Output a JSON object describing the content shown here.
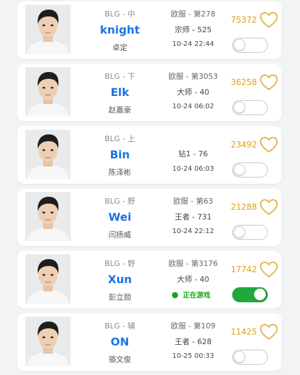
{
  "colors": {
    "accent": "#1a73e8",
    "score": "#d9a21b",
    "heart": "#e0b13a",
    "online": "#1aa31a",
    "toggle_on": "#22a83a"
  },
  "players": [
    {
      "team_role": "BLG - 中",
      "nickname": "knight",
      "real_name": "卓定",
      "server_rank": "欧服 - 第278",
      "tier": "宗师 - 525",
      "last_seen": "10-24 22:44",
      "status": "",
      "score": "75372",
      "toggle_on": false
    },
    {
      "team_role": "BLG - 下",
      "nickname": "Elk",
      "real_name": "赵嘉豪",
      "server_rank": "欧服 - 第3053",
      "tier": "大师 - 40",
      "last_seen": "10-24 06:02",
      "status": "",
      "score": "36258",
      "toggle_on": false
    },
    {
      "team_role": "BLG - 上",
      "nickname": "Bin",
      "real_name": "陈泽彬",
      "server_rank": "",
      "tier": "钻1 - 76",
      "last_seen": "10-24 06:03",
      "status": "",
      "score": "23492",
      "toggle_on": false
    },
    {
      "team_role": "BLG - 野",
      "nickname": "Wei",
      "real_name": "闫扬威",
      "server_rank": "欧服 - 第63",
      "tier": "王者 - 731",
      "last_seen": "10-24 22:12",
      "status": "",
      "score": "21288",
      "toggle_on": false
    },
    {
      "team_role": "BLG - 野",
      "nickname": "Xun",
      "real_name": "彭立勋",
      "server_rank": "欧服 - 第3176",
      "tier": "大师 - 40",
      "last_seen": "",
      "status": "正在游戏",
      "score": "17742",
      "toggle_on": true
    },
    {
      "team_role": "BLG - 辅",
      "nickname": "ON",
      "real_name": "骆文俊",
      "server_rank": "欧服 - 第109",
      "tier": "王者 - 628",
      "last_seen": "10-25 00:33",
      "status": "",
      "score": "11425",
      "toggle_on": false
    }
  ]
}
